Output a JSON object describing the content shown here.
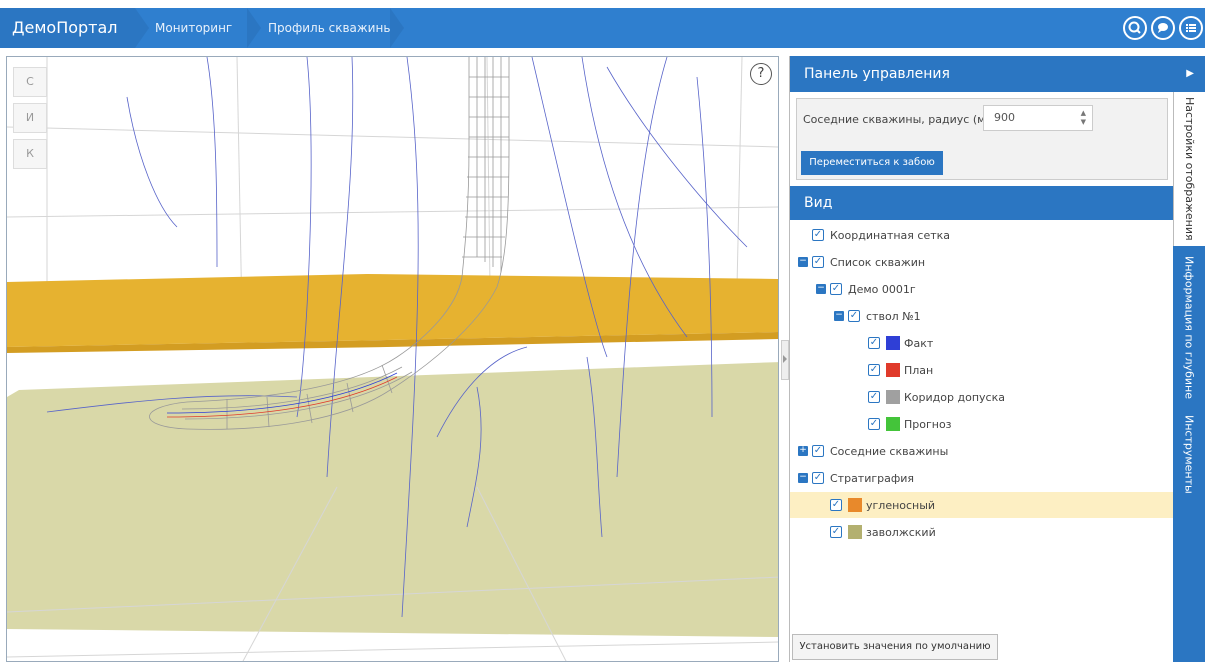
{
  "topbar": {
    "brand": "ДемоПортал",
    "breadcrumbs": [
      "Мониторинг",
      "Профиль скважины"
    ],
    "icons": [
      "search-icon",
      "chat-icon",
      "menu-list-icon"
    ]
  },
  "viewport": {
    "view_buttons": [
      "С",
      "И",
      "К"
    ],
    "help": "?"
  },
  "panel": {
    "title": "Панель управления",
    "neighbors_label": "Соседние скважины, радиус (м.):",
    "radius_value": "900",
    "move_button": "Переместиться к забою",
    "view_title": "Вид",
    "default_button": "Установить значения по умолчанию"
  },
  "tree": [
    {
      "label": "Координатная сетка",
      "level": 0,
      "toggle": "",
      "color": ""
    },
    {
      "label": "Список скважин",
      "level": 0,
      "toggle": "−",
      "color": ""
    },
    {
      "label": "Демо 0001г",
      "level": 1,
      "toggle": "−",
      "color": ""
    },
    {
      "label": "ствол №1",
      "level": 2,
      "toggle": "−",
      "color": ""
    },
    {
      "label": "Факт",
      "level": 3,
      "toggle": "",
      "color": "#2f3fd6"
    },
    {
      "label": "План",
      "level": 3,
      "toggle": "",
      "color": "#e03a2a"
    },
    {
      "label": "Коридор допуска",
      "level": 3,
      "toggle": "",
      "color": "#a0a0a0"
    },
    {
      "label": "Прогноз",
      "level": 3,
      "toggle": "",
      "color": "#44c43a"
    },
    {
      "label": "Соседние скважины",
      "level": 0,
      "toggle": "+",
      "color": ""
    },
    {
      "label": "Стратиграфия",
      "level": 0,
      "toggle": "−",
      "color": ""
    },
    {
      "label": "угленосный",
      "level": 1,
      "toggle": "",
      "color": "#e8892b",
      "selected": true
    },
    {
      "label": "заволжский",
      "level": 1,
      "toggle": "",
      "color": "#b3b070"
    }
  ],
  "vtabs": [
    "Настройки отображения",
    "Информация по глубине",
    "Инструменты"
  ],
  "colors": {
    "accent": "#2b76c2",
    "layer_top": "#e6b230",
    "layer_bottom": "#d9d8a8"
  }
}
